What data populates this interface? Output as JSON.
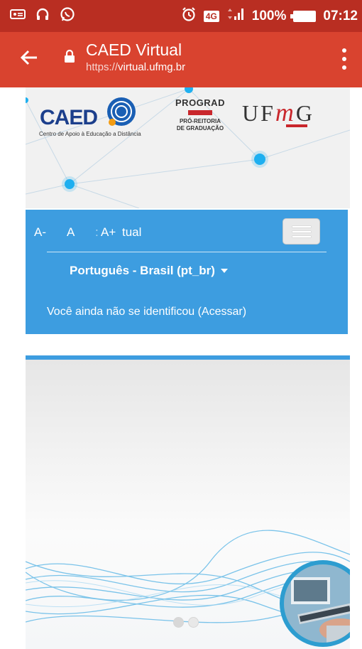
{
  "status_bar": {
    "badge": "4G",
    "battery": "100%",
    "time": "07:12",
    "icons": [
      "voicemail-icon",
      "headphones-icon",
      "whatsapp-icon",
      "alarm-icon",
      "signal-icon",
      "battery-icon"
    ]
  },
  "toolbar": {
    "title": "CAED Virtual",
    "url_scheme": "https://",
    "url_host": "virtual.ufmg.br"
  },
  "header": {
    "caed_logo_text": "CAED",
    "caed_subtitle": "Centro de Apoio à Educação a Distância",
    "prograd_title": "PROGRAD",
    "prograd_sub_1": "PRÓ-REITORIA",
    "prograd_sub_2": "DE GRADUAÇÃO",
    "ufmg_text_u": "U",
    "ufmg_text_f": "F",
    "ufmg_text_m": "m",
    "ufmg_text_g": "G"
  },
  "nav": {
    "font_decrease": "A-",
    "font_normal": "A",
    "font_separator": ":",
    "font_increase": "A+",
    "brand_fragment": "tual",
    "language": "Português - Brasil (pt_br)",
    "login_status": "Você ainda não se identificou (Acessar)"
  },
  "slideshow": {
    "slide_count": 2,
    "active_slide": 1
  },
  "colors": {
    "status_bar": "#b92e22",
    "toolbar": "#d9432f",
    "nav_panel": "#3d9de0",
    "ufmg_red": "#c9272c"
  }
}
